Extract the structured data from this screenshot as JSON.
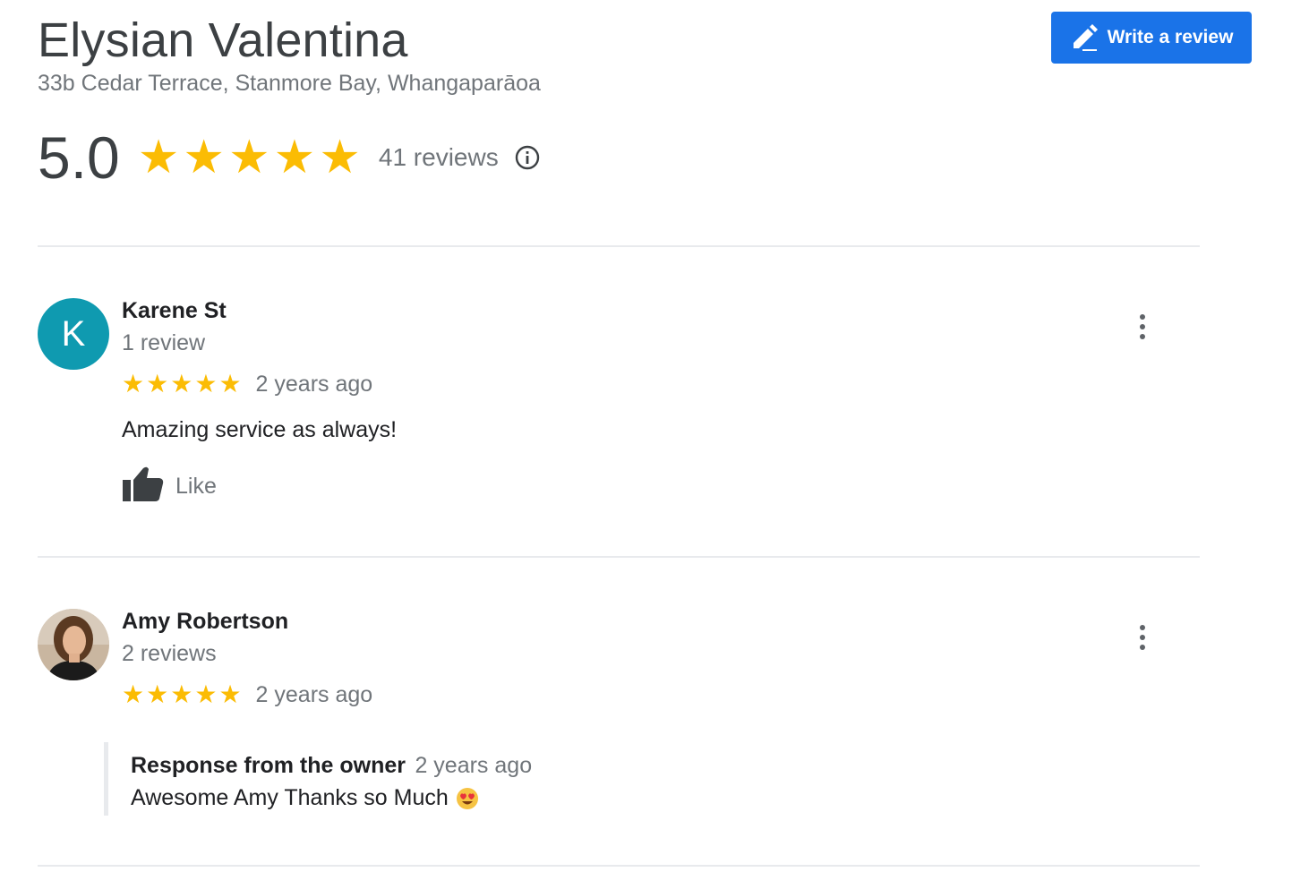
{
  "business": {
    "name": "Elysian Valentina",
    "address": "33b Cedar Terrace, Stanmore Bay, Whangaparāoa",
    "write_review_label": "Write a review"
  },
  "rating": {
    "score": "5.0",
    "stars": 5,
    "review_count_label": "41 reviews",
    "star_color": "#fbbc04"
  },
  "reviews": [
    {
      "avatar_letter": "K",
      "avatar_color": "#0f9ab0",
      "name": "Karene St",
      "reviewer_reviews": "1 review",
      "stars": 5,
      "time_ago": "2 years ago",
      "text": "Amazing service as always!",
      "like_label": "Like"
    },
    {
      "avatar": "photo",
      "name": "Amy Robertson",
      "reviewer_reviews": "2 reviews",
      "stars": 5,
      "time_ago": "2 years ago",
      "owner_response": {
        "label": "Response from the owner",
        "time_ago": "2 years ago",
        "text": "Awesome Amy Thanks so Much",
        "emoji": "heart-eyes-emoji"
      }
    }
  ],
  "colors": {
    "accent_button": "#1a73e8",
    "secondary_text": "#70757a",
    "divider": "#e8eaed"
  },
  "icons": [
    "edit-pencil-icon",
    "info-icon",
    "thumbs-up-icon",
    "more-vert-icon",
    "heart-eyes-emoji"
  ]
}
